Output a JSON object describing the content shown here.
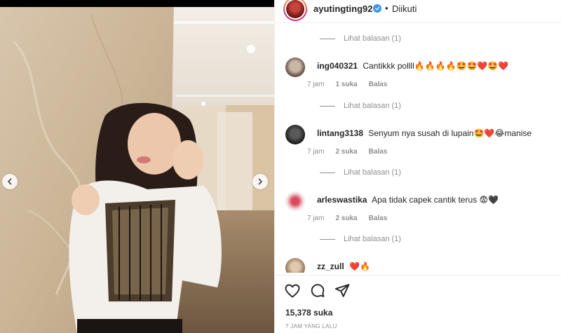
{
  "header": {
    "username": "ayutingting92",
    "separator": "•",
    "follow_status": "Diikuti"
  },
  "replies": [
    {
      "label": "Lihat balasan (1)"
    },
    {
      "label": "Lihat balasan (1)"
    },
    {
      "label": "Lihat balasan (1)"
    },
    {
      "label": "Lihat balasan (1)"
    }
  ],
  "comments": [
    {
      "username": "ing040321",
      "text": "Cantikkk pollll🔥🔥🔥🔥🤩🤩❤️🤩❤️",
      "time": "7 jam",
      "likes": "1 suka",
      "reply": "Balas"
    },
    {
      "username": "lintang3138",
      "text": "Senyum nya susah di lupain🤩❤️😂manise",
      "time": "7 jam",
      "likes": "2 suka",
      "reply": "Balas"
    },
    {
      "username": "arleswastika",
      "text": "Apa tidak capek cantik terus 😨🖤",
      "time": "7 jam",
      "likes": "2 suka",
      "reply": "Balas"
    },
    {
      "username": "zz_zull",
      "text": "❤️🔥"
    }
  ],
  "post": {
    "likes": "15,378 suka",
    "time_ago": "7 JAM YANG LALU"
  },
  "icons": {
    "like": "heart-icon",
    "comment": "comment-icon",
    "share": "share-icon",
    "prev": "chevron-left-icon",
    "next": "chevron-right-icon",
    "verified": "verified-badge-icon"
  },
  "colors": {
    "verified": "#3897f0",
    "muted": "#8e8e8e",
    "text": "#262626",
    "border": "#efefef"
  }
}
